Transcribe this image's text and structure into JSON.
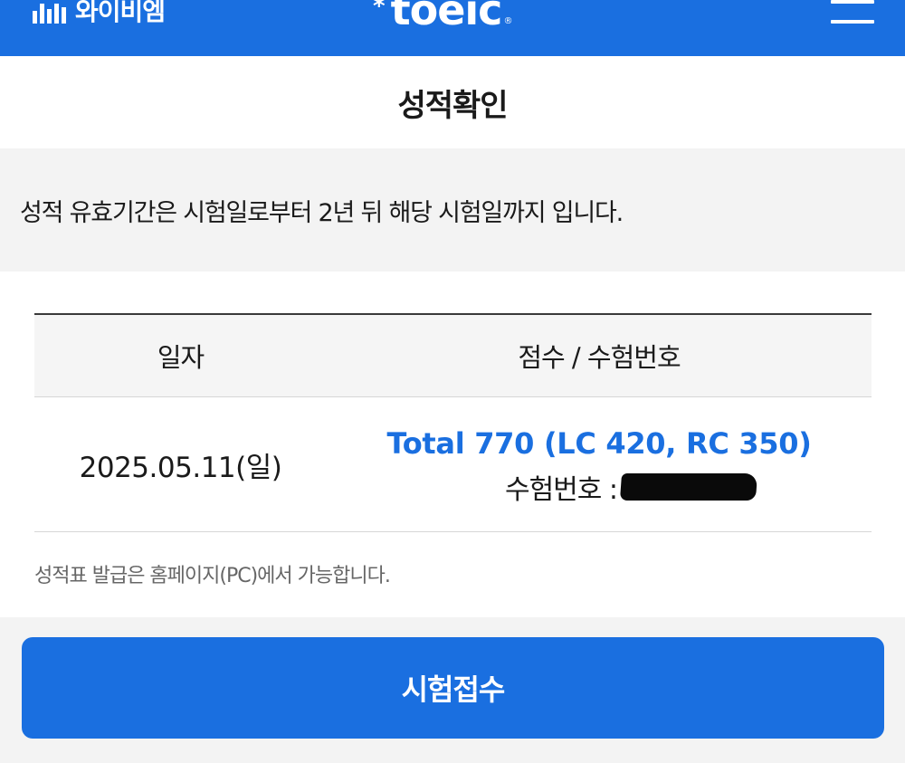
{
  "header": {
    "brand_logo_text": "와이비엠",
    "product_logo_text": "toeic",
    "product_logo_mark": "*",
    "product_logo_reg": "®",
    "menu_icon": "hamburger-menu-icon",
    "background_color": "#1a6fe0"
  },
  "page": {
    "title": "성적확인"
  },
  "notice": {
    "text": "성적 유효기간은 시험일로부터 2년 뒤 해당 시험일까지 입니다."
  },
  "score_table": {
    "columns": [
      "일자",
      "점수 / 수험번호"
    ],
    "rows": [
      {
        "date": "2025.05.11(일)",
        "total_score": "Total 770 (LC 420, RC 350)",
        "exam_number_label": "수험번호 :",
        "exam_number_redacted": true
      }
    ]
  },
  "footnote": {
    "text": "성적표 발급은 홈페이지(PC)에서 가능합니다."
  },
  "actions": {
    "register_label": "시험접수"
  },
  "colors": {
    "accent": "#1a6fe0",
    "text": "#1a1a1a",
    "muted_text": "#666666",
    "panel_bg": "#f3f3f3"
  }
}
